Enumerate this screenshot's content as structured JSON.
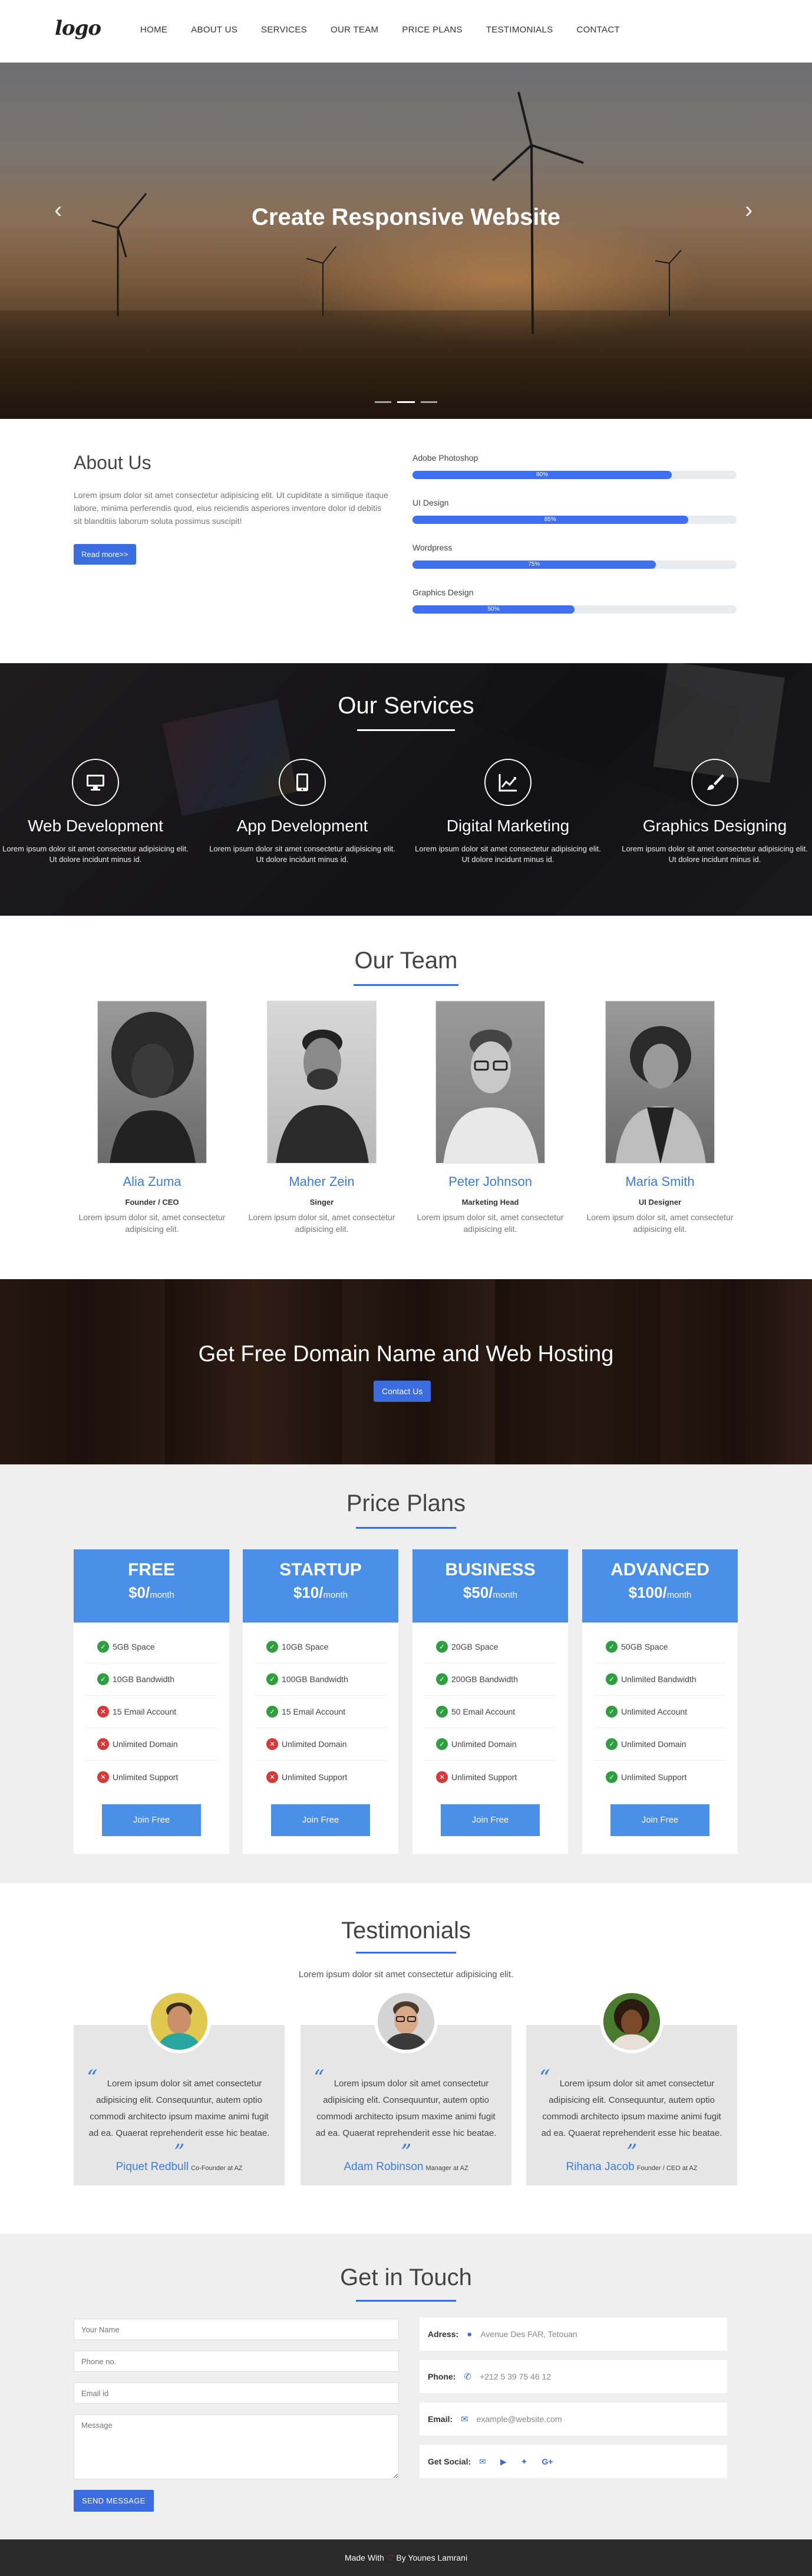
{
  "nav": {
    "logo": "logo",
    "items": [
      "HOME",
      "ABOUT US",
      "SERVICES",
      "OUR TEAM",
      "PRICE PLANS",
      "TESTIMONIALS",
      "CONTACT"
    ]
  },
  "hero": {
    "title": "Create Responsive Website",
    "prev_icon": "chevron-left-icon",
    "next_icon": "chevron-right-icon",
    "slides": 3,
    "active_slide": 2
  },
  "about": {
    "title": "About Us",
    "text": "Lorem ipsum dolor sit amet consectetur adipisicing elit. Ut cupiditate a similique itaque labore, minima perferendis quod, eius reiciendis asperiores inventore dolor id debitis sit blanditiis laborum soluta possimus suscipit!",
    "button": "Read more>>",
    "skills": [
      {
        "name": "Adobe Photoshop",
        "percent": 80,
        "label": "80%"
      },
      {
        "name": "UI Design",
        "percent": 85,
        "label": "85%"
      },
      {
        "name": "Wordpress",
        "percent": 75,
        "label": "75%"
      },
      {
        "name": "Graphics Design",
        "percent": 50,
        "label": "50%"
      }
    ]
  },
  "services": {
    "title": "Our Services",
    "items": [
      {
        "icon": "desktop-icon",
        "title": "Web Development",
        "text": "Lorem ipsum dolor sit amet consectetur adipisicing elit. Ut dolore incidunt minus id."
      },
      {
        "icon": "tablet-icon",
        "title": "App Development",
        "text": "Lorem ipsum dolor sit amet consectetur adipisicing elit. Ut dolore incidunt minus id."
      },
      {
        "icon": "chart-line-icon",
        "title": "Digital Marketing",
        "text": "Lorem ipsum dolor sit amet consectetur adipisicing elit. Ut dolore incidunt minus id."
      },
      {
        "icon": "paint-brush-icon",
        "title": "Graphics Designing",
        "text": "Lorem ipsum dolor sit amet consectetur adipisicing elit. Ut dolore incidunt minus id."
      }
    ]
  },
  "team": {
    "title": "Our Team",
    "members": [
      {
        "name": "Alia Zuma",
        "role": "Founder / CEO",
        "text": "Lorem ipsum dolor sit, amet consectetur adipisicing elit."
      },
      {
        "name": "Maher Zein",
        "role": "Singer",
        "text": "Lorem ipsum dolor sit, amet consectetur adipisicing elit."
      },
      {
        "name": "Peter Johnson",
        "role": "Marketing Head",
        "text": "Lorem ipsum dolor sit, amet consectetur adipisicing elit."
      },
      {
        "name": "Maria Smith",
        "role": "UI Designer",
        "text": "Lorem ipsum dolor sit, amet consectetur adipisicing elit."
      }
    ]
  },
  "banner": {
    "title": "Get Free Domain Name and Web Hosting",
    "button": "Contact Us"
  },
  "price": {
    "title": "Price Plans",
    "plans": [
      {
        "name": "FREE",
        "price": "$0/",
        "per": "month",
        "button": "Join Free",
        "features": [
          {
            "text": "5GB Space",
            "ok": true
          },
          {
            "text": "10GB Bandwidth",
            "ok": true
          },
          {
            "text": "15 Email Account",
            "ok": false
          },
          {
            "text": "Unlimited Domain",
            "ok": false
          },
          {
            "text": "Unlimited Support",
            "ok": false
          }
        ]
      },
      {
        "name": "STARTUP",
        "price": "$10/",
        "per": "month",
        "button": "Join Free",
        "features": [
          {
            "text": "10GB Space",
            "ok": true
          },
          {
            "text": "100GB Bandwidth",
            "ok": true
          },
          {
            "text": "15 Email Account",
            "ok": true
          },
          {
            "text": "Unlimited Domain",
            "ok": false
          },
          {
            "text": "Unlimited Support",
            "ok": false
          }
        ]
      },
      {
        "name": "BUSINESS",
        "price": "$50/",
        "per": "month",
        "button": "Join Free",
        "features": [
          {
            "text": "20GB Space",
            "ok": true
          },
          {
            "text": "200GB Bandwidth",
            "ok": true
          },
          {
            "text": "50 Email Account",
            "ok": true
          },
          {
            "text": "Unlimited Domain",
            "ok": true
          },
          {
            "text": "Unlimited Support",
            "ok": false
          }
        ]
      },
      {
        "name": "ADVANCED",
        "price": "$100/",
        "per": "month",
        "button": "Join Free",
        "features": [
          {
            "text": "50GB Space",
            "ok": true
          },
          {
            "text": "Unlimited Bandwidth",
            "ok": true
          },
          {
            "text": "Unlimited Account",
            "ok": true
          },
          {
            "text": "Unlimited Domain",
            "ok": true
          },
          {
            "text": "Unlimited Support",
            "ok": true
          }
        ]
      }
    ]
  },
  "testimonials": {
    "title": "Testimonials",
    "subtitle": "Lorem ipsum dolor sit amet consectetur adipisicing elit.",
    "items": [
      {
        "quote": "Lorem ipsum dolor sit amet consectetur adipisicing elit. Consequuntur, autem optio commodi architecto ipsum maxime animi fugit ad ea. Quaerat reprehenderit esse hic beatae.",
        "name": "Piquet Redbull",
        "role": "Co-Founder at AZ"
      },
      {
        "quote": "Lorem ipsum dolor sit amet consectetur adipisicing elit. Consequuntur, autem optio commodi architecto ipsum maxime animi fugit ad ea. Quaerat reprehenderit esse hic beatae.",
        "name": "Adam Robinson",
        "role": "Manager at AZ"
      },
      {
        "quote": "Lorem ipsum dolor sit amet consectetur adipisicing elit. Consequuntur, autem optio commodi architecto ipsum maxime animi fugit ad ea. Quaerat reprehenderit esse hic beatae.",
        "name": "Rihana Jacob",
        "role": "Founder / CEO at AZ"
      }
    ]
  },
  "contact": {
    "title": "Get in Touch",
    "placeholders": {
      "name": "Your Name",
      "phone": "Phone no.",
      "email": "Email id",
      "message": "Message"
    },
    "button": "SEND MESSAGE",
    "address_label": "Adress:",
    "address": "Avenue Des FAR, Tetouan",
    "phone_label": "Phone:",
    "phone": "+212 5 39 75 46 12",
    "email_label": "Email:",
    "email": "example@website.com",
    "social_label": "Get Social:",
    "social_icons": [
      "envelope-icon",
      "youtube-icon",
      "twitter-icon",
      "google-plus-icon"
    ]
  },
  "footer": {
    "made_with": "Made With",
    "by": "By Younes Lamrani"
  },
  "colors": {
    "accent": "#3b6de0",
    "plan_header": "#4a90e8",
    "check": "#2e9e3e",
    "cross": "#d93838"
  }
}
